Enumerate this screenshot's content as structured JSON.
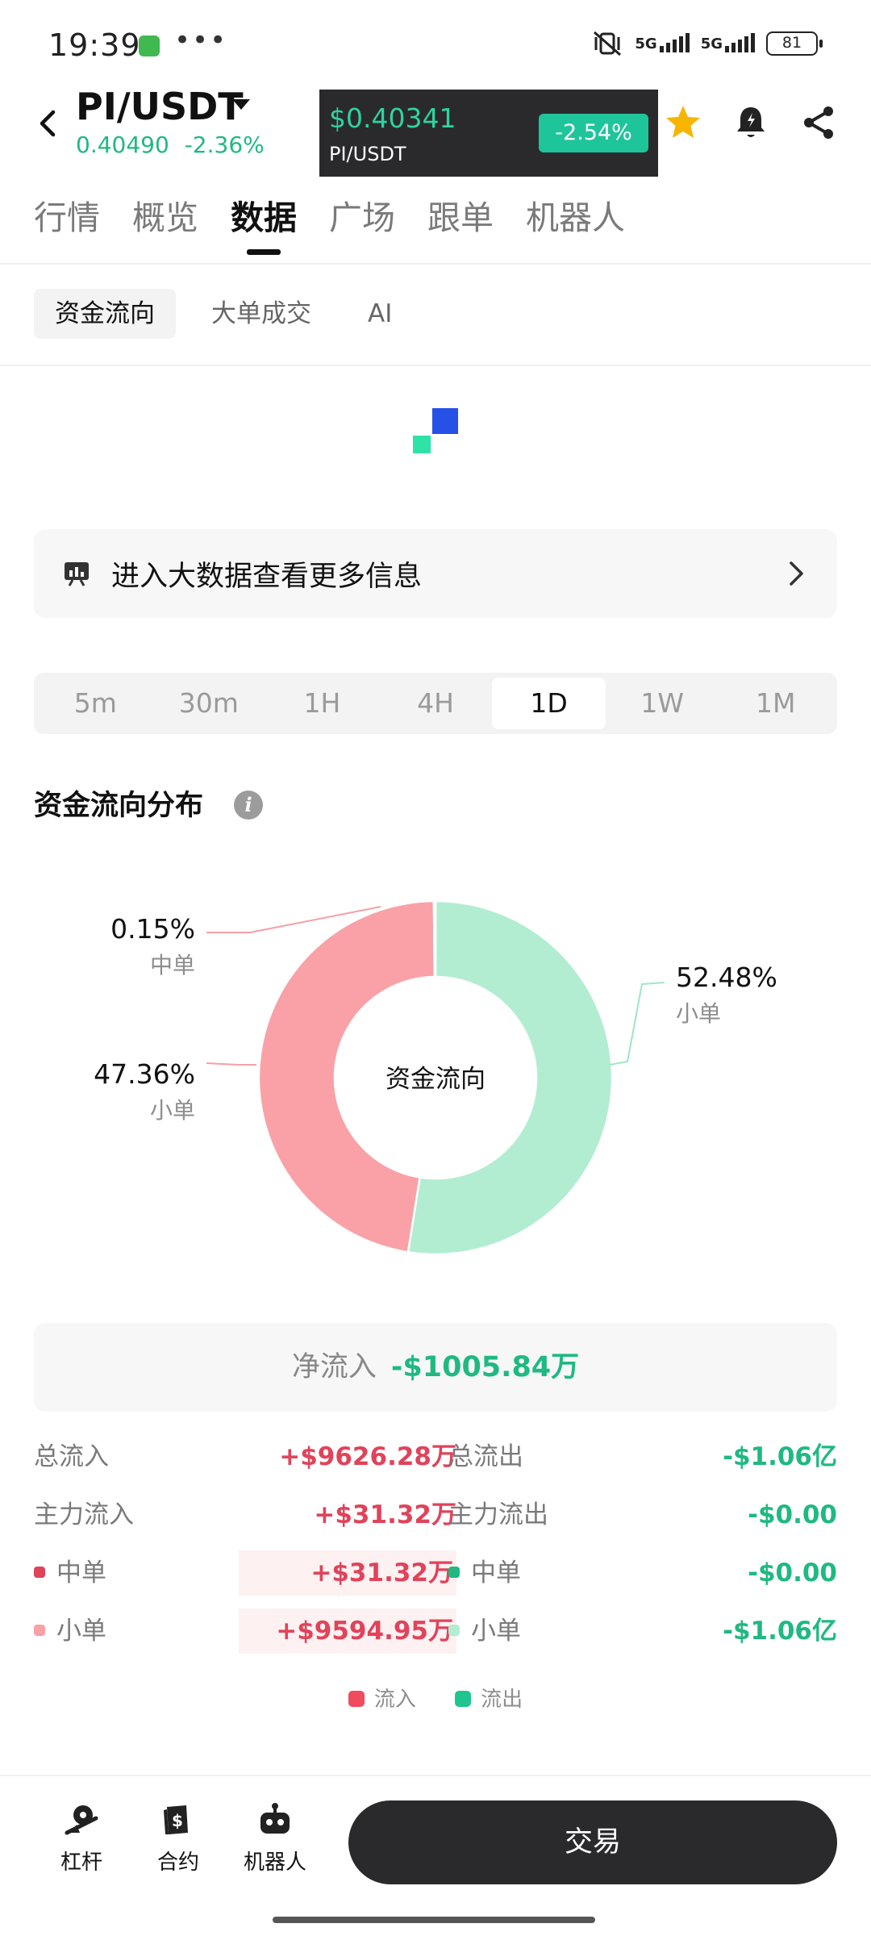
{
  "status_bar": {
    "time": "19:39",
    "net1": "5G",
    "net2": "5G",
    "battery": "81"
  },
  "header": {
    "pair": "PI/USDT",
    "last_price": "0.40490",
    "change": "-2.36%",
    "ticker": {
      "price": "$0.40341",
      "pair": "PI/USDT",
      "change": "-2.54%"
    }
  },
  "tabs": [
    "行情",
    "概览",
    "数据",
    "广场",
    "跟单",
    "机器人"
  ],
  "subtabs": [
    "资金流向",
    "大单成交",
    "AI"
  ],
  "bigdata_text": "进入大数据查看更多信息",
  "intervals": [
    "5m",
    "30m",
    "1H",
    "4H",
    "1D",
    "1W",
    "1M"
  ],
  "active_interval": "1D",
  "section_title": "资金流向分布",
  "chart_data": {
    "type": "pie",
    "center_label": "资金流向",
    "slices": [
      {
        "name": "小单",
        "flow": "流出",
        "value": 52.48,
        "label": "52.48%",
        "color": "#b2edd2"
      },
      {
        "name": "小单",
        "flow": "流入",
        "value": 47.36,
        "label": "47.36%",
        "color": "#f9a1a6"
      },
      {
        "name": "中单",
        "flow": "流入",
        "value": 0.15,
        "label": "0.15%",
        "color": "#f9a1a6"
      }
    ]
  },
  "net_inflow": {
    "label": "净流入",
    "value": "-$1005.84万"
  },
  "flows": {
    "total_in_label": "总流入",
    "total_in": "+$9626.28万",
    "total_out_label": "总流出",
    "total_out": "-$1.06亿",
    "main_in_label": "主力流入",
    "main_in": "+$31.32万",
    "main_out_label": "主力流出",
    "main_out": "-$0.00",
    "mid_in_label": "中单",
    "mid_in": "+$31.32万",
    "mid_out_label": "中单",
    "mid_out": "-$0.00",
    "small_in_label": "小单",
    "small_in": "+$9594.95万",
    "small_out_label": "小单",
    "small_out": "-$1.06亿"
  },
  "legend": {
    "in": "流入",
    "out": "流出"
  },
  "colors": {
    "inflow": "#e0435a",
    "outflow": "#1fb981",
    "inflow_light": "#f9a1a6",
    "outflow_light": "#b2edd2"
  },
  "bottom_nav": [
    "杠杆",
    "合约",
    "机器人"
  ],
  "trade_button": "交易"
}
